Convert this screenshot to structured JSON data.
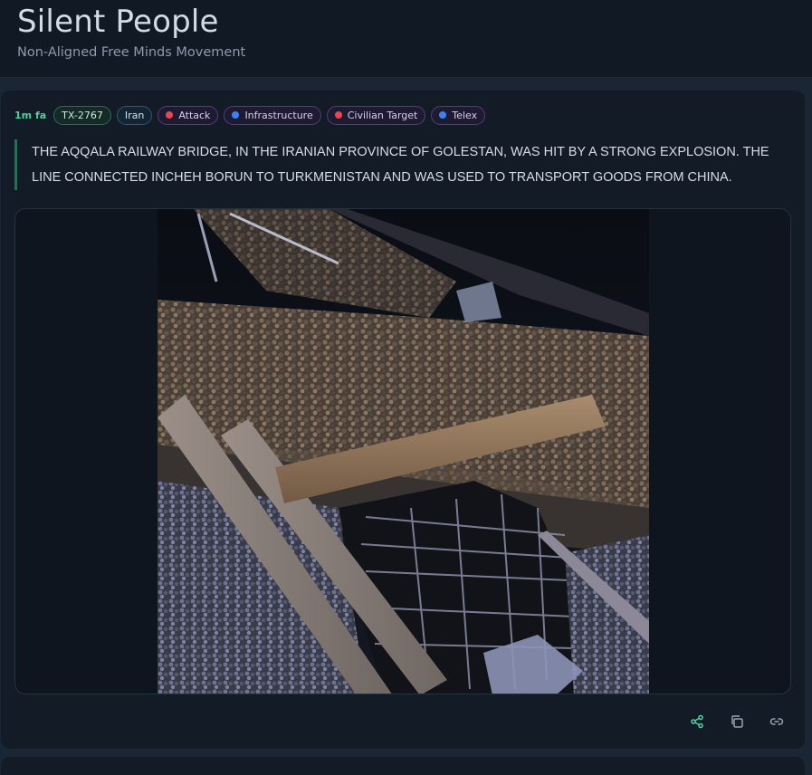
{
  "header": {
    "title": "Silent People",
    "subtitle": "Non-Aligned Free Minds Movement"
  },
  "post": {
    "time": "1m fa",
    "id_tag": "TX-2767",
    "country_tag": "Iran",
    "categories": [
      {
        "label": "Attack",
        "dot_color": "#e5484d"
      },
      {
        "label": "Infrastructure",
        "dot_color": "#3b82f6"
      },
      {
        "label": "Civilian Target",
        "dot_color": "#e5484d"
      },
      {
        "label": "Telex",
        "dot_color": "#3b82f6"
      }
    ],
    "text": "THE AQQALA RAILWAY BRIDGE, IN THE IRANIAN PROVINCE OF GOLESTAN, WAS HIT BY A STRONG EXPLOSION. THE LINE CONNECTED INCHEH BORUN TO TURKMENISTAN AND WAS USED TO TRANSPORT GOODS FROM CHINA.",
    "actions": {
      "share_icon": "share-icon",
      "copy_icon": "copy-icon",
      "link_icon": "link-icon"
    }
  },
  "colors": {
    "accent_green": "#4fd1a0",
    "attack_red": "#e5484d",
    "info_blue": "#3b82f6",
    "background": "#1b2634",
    "card": "#131b26"
  }
}
